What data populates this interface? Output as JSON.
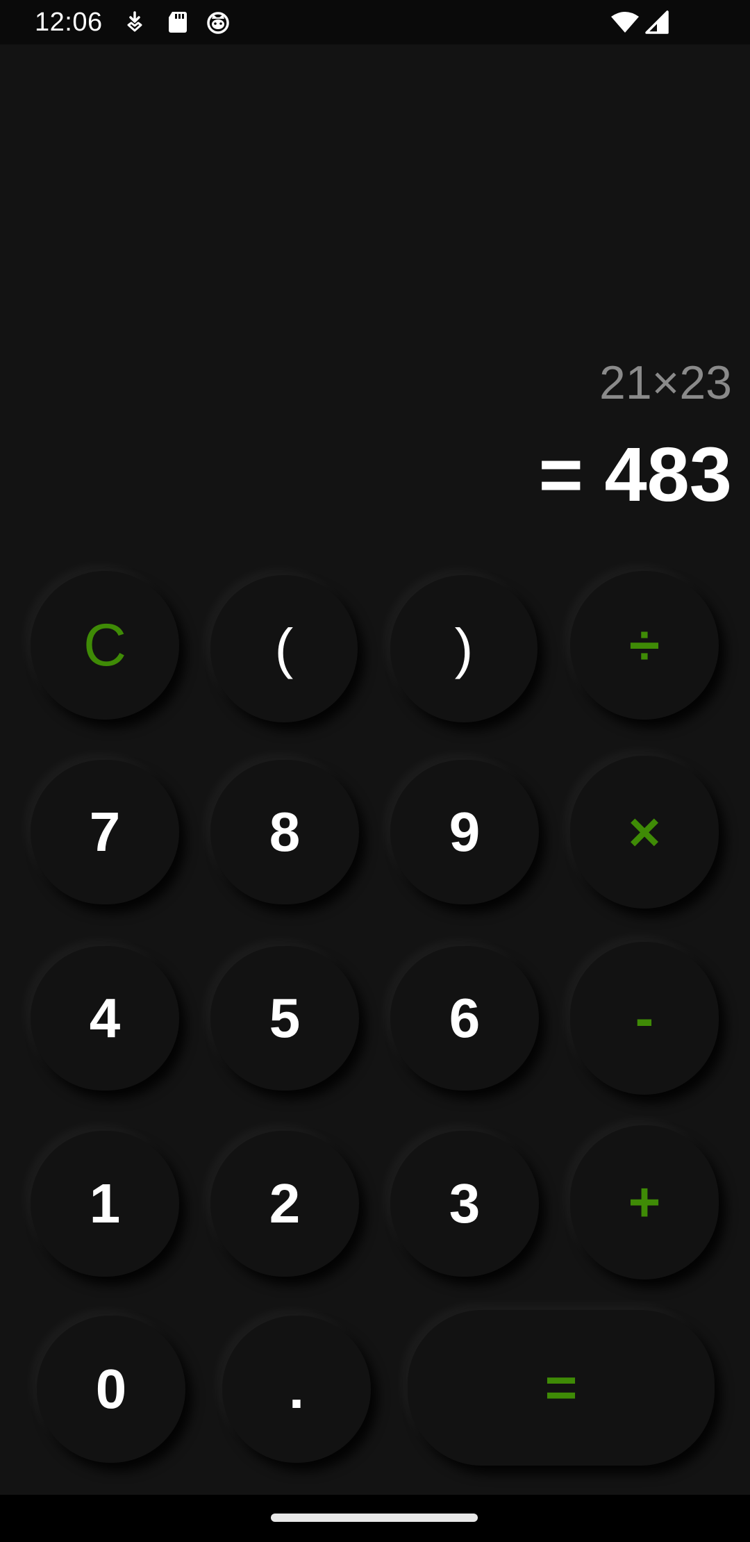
{
  "status_bar": {
    "time": "12:06",
    "icons": [
      "download-notification-icon",
      "sd-card-icon",
      "cat-face-icon",
      "wifi-icon",
      "cell-signal-icon"
    ]
  },
  "display": {
    "expression": "21×23",
    "result": "= 483"
  },
  "keypad": {
    "clear": "C",
    "open_paren": "(",
    "close_paren": ")",
    "divide": "÷",
    "seven": "7",
    "eight": "8",
    "nine": "9",
    "multiply": "×",
    "four": "4",
    "five": "5",
    "six": "6",
    "minus": "-",
    "one": "1",
    "two": "2",
    "three": "3",
    "plus": "+",
    "zero": "0",
    "decimal": ".",
    "equals": "="
  },
  "colors": {
    "background": "#131313",
    "key": "#121212",
    "accent": "#3f8b06",
    "expression_text": "#8a8a8a",
    "result_text": "#ffffff"
  }
}
